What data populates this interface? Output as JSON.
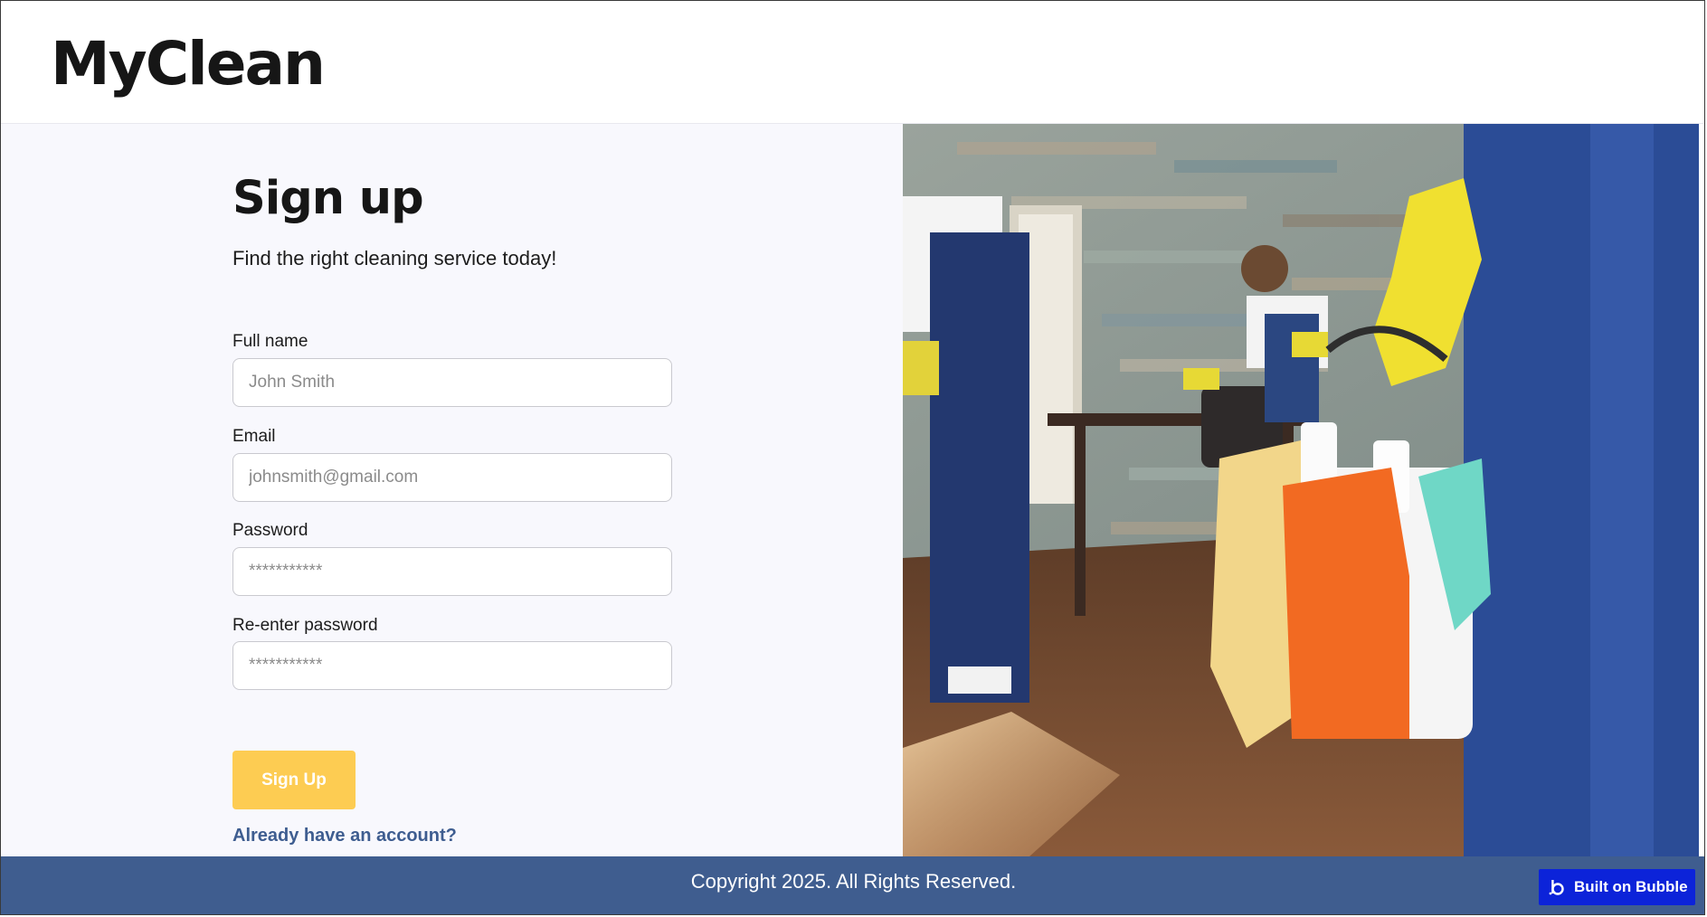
{
  "brand": {
    "name": "MyClean"
  },
  "signup": {
    "title": "Sign up",
    "subtitle": "Find the right cleaning service today!",
    "fields": [
      {
        "label": "Full name",
        "placeholder": "John Smith",
        "type": "text"
      },
      {
        "label": "Email",
        "placeholder": "johnsmith@gmail.com",
        "type": "email"
      },
      {
        "label": "Password",
        "placeholder": "***********",
        "type": "password"
      },
      {
        "label": "Re-enter password",
        "placeholder": "***********",
        "type": "password"
      }
    ],
    "submit_label": "Sign Up",
    "signin_link": "Already have an account?"
  },
  "hero": {
    "image": "cleaning-crew-photo"
  },
  "footer": {
    "copyright": "Copyright 2025. All Rights Reserved.",
    "badge_label": "Built on Bubble",
    "badge_icon": "bubble-logo-icon"
  },
  "colors": {
    "accent": "#fdcc52",
    "footer_bg": "#3f5d8f",
    "link": "#3e5d90",
    "panel_bg": "#f8f8fd",
    "badge_bg": "#0c23d9"
  }
}
